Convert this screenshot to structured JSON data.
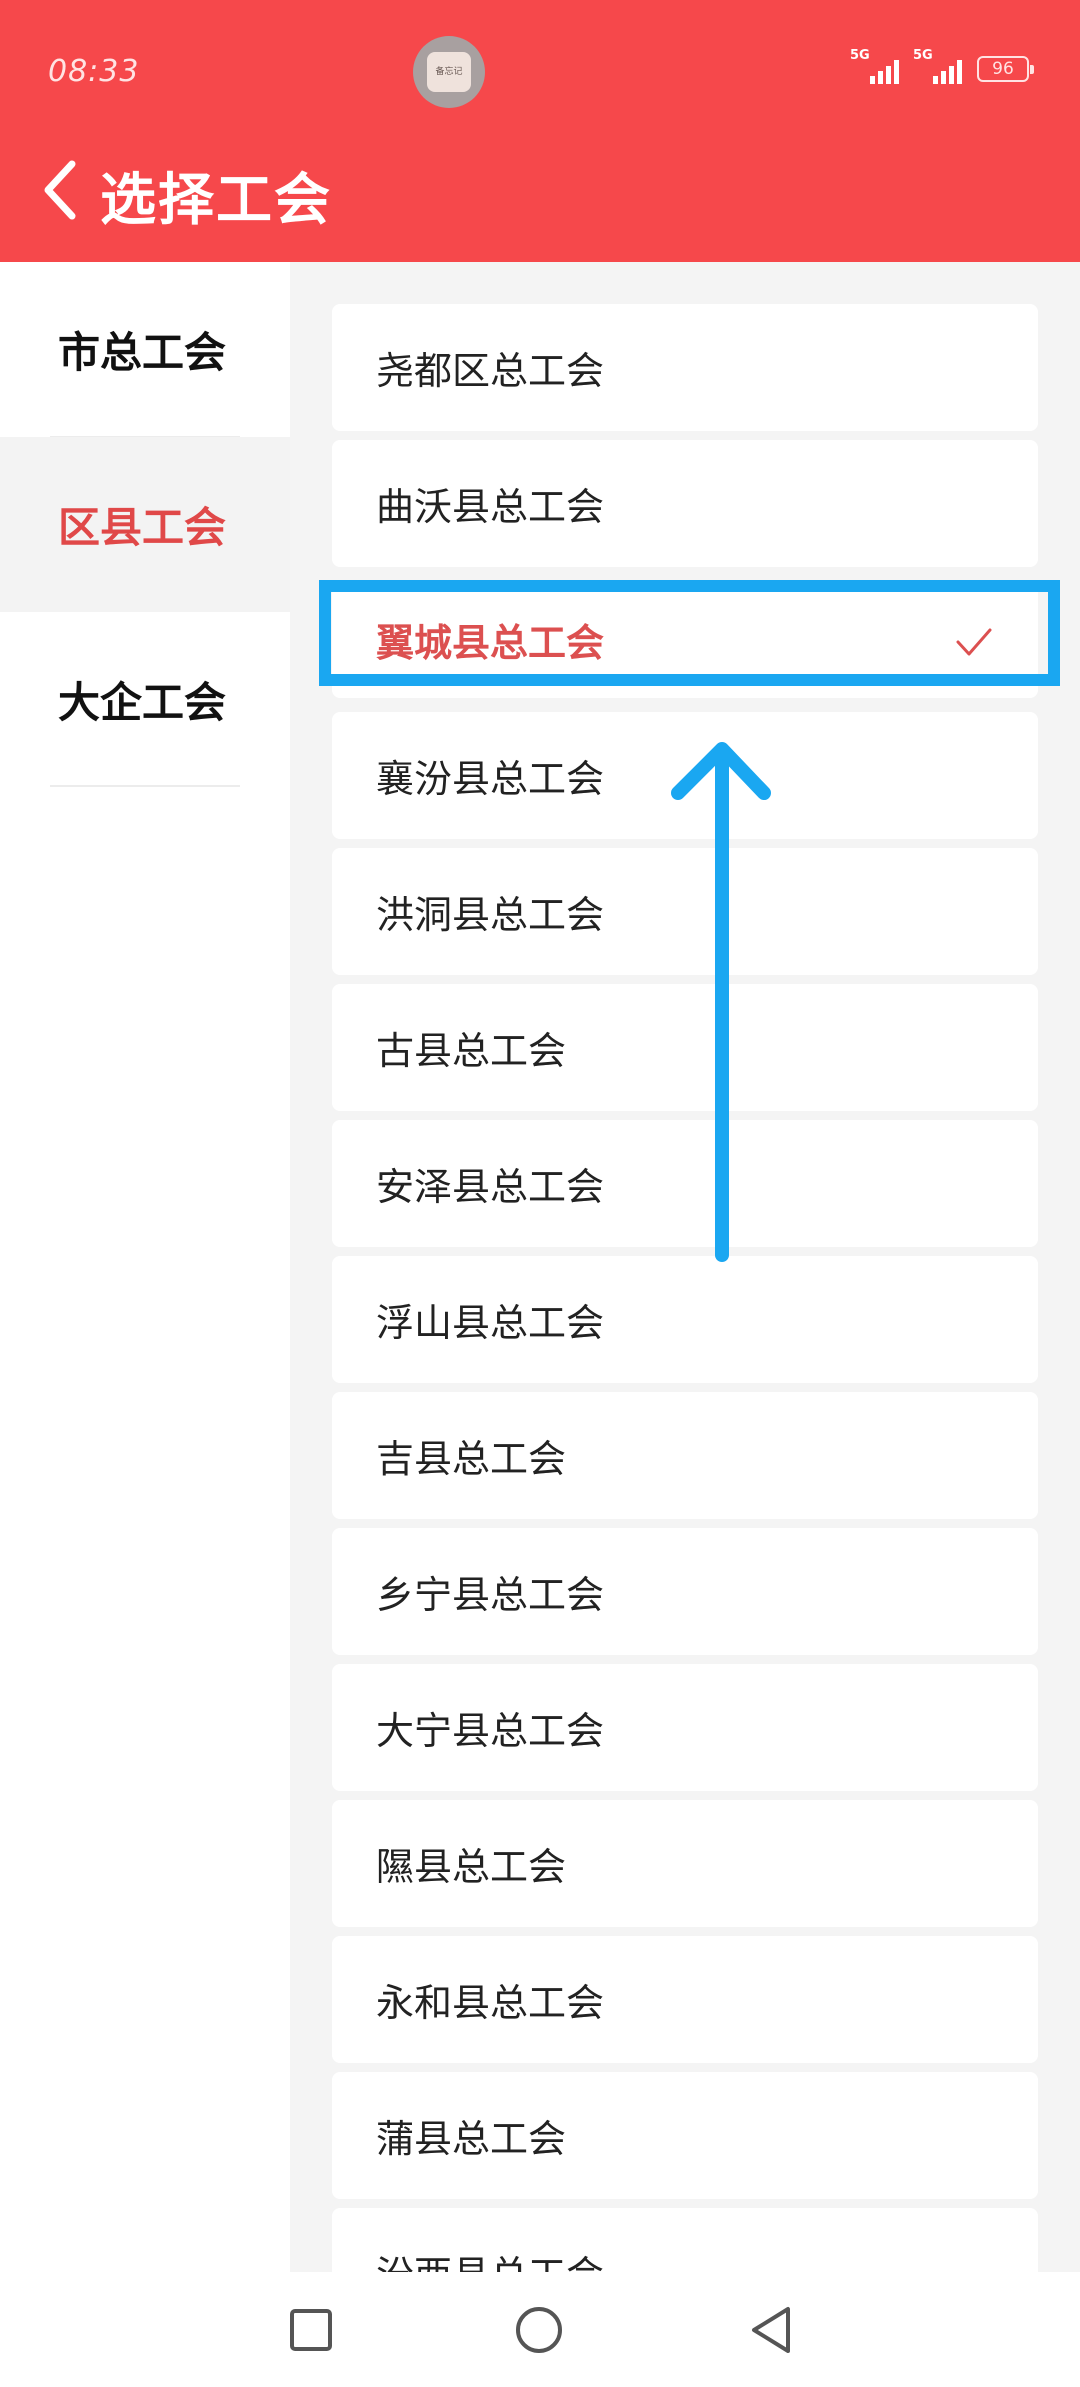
{
  "status_bar": {
    "time": "08:33",
    "avatar_label": "备忘记",
    "signal_1": "5G",
    "signal_2": "5G",
    "battery": "96"
  },
  "header": {
    "title": "选择工会",
    "back_icon": "chevron-left-icon"
  },
  "categories": [
    {
      "label": "市总工会",
      "active": false
    },
    {
      "label": "区县工会",
      "active": true
    },
    {
      "label": "大企工会",
      "active": false
    }
  ],
  "unions": [
    {
      "label": "尧都区总工会"
    },
    {
      "label": "曲沃县总工会"
    },
    {
      "label": "翼城县总工会",
      "selected": true
    },
    {
      "label": "襄汾县总工会"
    },
    {
      "label": "洪洞县总工会"
    },
    {
      "label": "古县总工会"
    },
    {
      "label": "安泽县总工会"
    },
    {
      "label": "浮山县总工会"
    },
    {
      "label": "吉县总工会"
    },
    {
      "label": "乡宁县总工会"
    },
    {
      "label": "大宁县总工会"
    },
    {
      "label": "隰县总工会"
    },
    {
      "label": "永和县总工会"
    },
    {
      "label": "蒲县总工会"
    },
    {
      "label": "汾西县总工会"
    }
  ],
  "colors": {
    "header_bg": "#f6484b",
    "accent_red": "#dc5050",
    "annotation_blue": "#1aa7f1"
  },
  "navbar": {
    "icons": [
      "recent-apps-square-icon",
      "home-circle-icon",
      "back-triangle-icon"
    ]
  }
}
